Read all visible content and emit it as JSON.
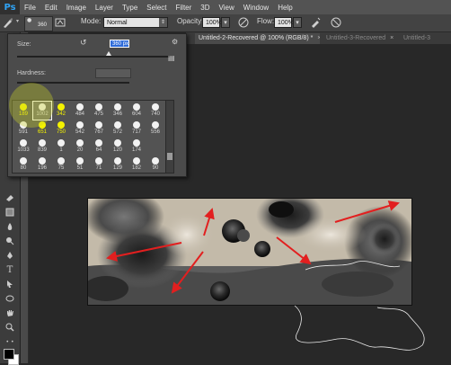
{
  "app": {
    "logo": "Ps"
  },
  "menu": [
    "File",
    "Edit",
    "Image",
    "Layer",
    "Type",
    "Select",
    "Filter",
    "3D",
    "View",
    "Window",
    "Help"
  ],
  "options": {
    "brush_size_value": "360",
    "mode_label": "Mode:",
    "mode_value": "Normal",
    "opacity_label": "Opacity:",
    "opacity_value": "100%",
    "flow_label": "Flow:",
    "flow_value": "100%"
  },
  "tabs": [
    {
      "label": "Untitled-2-Recovered @ 100% (RGB/8) *",
      "active": true
    },
    {
      "label": "Untitled-3-Recovered",
      "active": false
    },
    {
      "label": "Untitled-3",
      "active": false
    }
  ],
  "brush_panel": {
    "size_label": "Size:",
    "size_value": "360 px",
    "size_fraction": 0.6,
    "hardness_label": "Hardness:",
    "hardness_fraction": 0.0,
    "presets": [
      {
        "n": "189",
        "yellow": true
      },
      {
        "n": "1002",
        "yellow": false,
        "selected": true
      },
      {
        "n": "342",
        "yellow": true
      },
      {
        "n": "484",
        "yellow": false
      },
      {
        "n": "475",
        "yellow": false
      },
      {
        "n": "346",
        "yellow": false
      },
      {
        "n": "604",
        "yellow": false
      },
      {
        "n": "740",
        "yellow": false
      },
      {
        "n": "591",
        "yellow": false
      },
      {
        "n": "651",
        "yellow": true
      },
      {
        "n": "750",
        "yellow": true
      },
      {
        "n": "542",
        "yellow": false
      },
      {
        "n": "767",
        "yellow": false
      },
      {
        "n": "572",
        "yellow": false
      },
      {
        "n": "717",
        "yellow": false
      },
      {
        "n": "556",
        "yellow": false
      },
      {
        "n": "1033",
        "yellow": false
      },
      {
        "n": "839",
        "yellow": false
      },
      {
        "n": "1",
        "yellow": false
      },
      {
        "n": "20",
        "yellow": false
      },
      {
        "n": "64",
        "yellow": false
      },
      {
        "n": "120",
        "yellow": false
      },
      {
        "n": "174",
        "yellow": false
      },
      {
        "n": "",
        "yellow": false
      },
      {
        "n": "80",
        "yellow": false
      },
      {
        "n": "196",
        "yellow": false
      },
      {
        "n": "75",
        "yellow": false
      },
      {
        "n": "51",
        "yellow": false
      },
      {
        "n": "71",
        "yellow": false
      },
      {
        "n": "129",
        "yellow": false
      },
      {
        "n": "182",
        "yellow": false
      },
      {
        "n": "90",
        "yellow": false
      }
    ]
  },
  "colors": {
    "accent_blue": "#2e6bd9",
    "annotation_red": "#e21f1f",
    "highlight_yellow": "#f4f200",
    "foreground": "#000000",
    "background": "#ffffff"
  }
}
